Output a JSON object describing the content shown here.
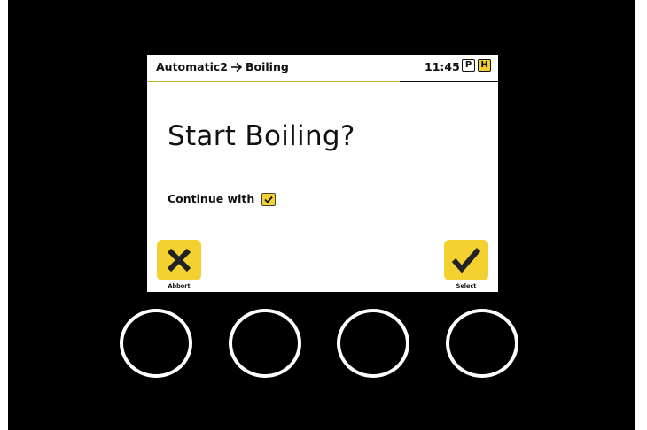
{
  "header": {
    "breadcrumb_from": "Automatic2",
    "breadcrumb_to": "Boiling",
    "time": "11:45",
    "badge_p": "P",
    "badge_h": "H",
    "progress": 0.72
  },
  "main": {
    "title": "Start Boiling?",
    "continue_label": "Continue with",
    "continue_checked": true
  },
  "actions": {
    "abort_label": "Abbort",
    "select_label": "Select"
  },
  "hardware_buttons": [
    "button-1",
    "button-2",
    "button-3",
    "button-4"
  ],
  "colors": {
    "accent": "#f2d131",
    "bezel": "#000000",
    "screen": "#ffffff",
    "progress": "#c9b42c"
  },
  "icons": {
    "breadcrumb_separator": "arrow-right-icon",
    "abort": "x-icon",
    "select": "check-icon",
    "checkbox": "checkmark-icon"
  }
}
